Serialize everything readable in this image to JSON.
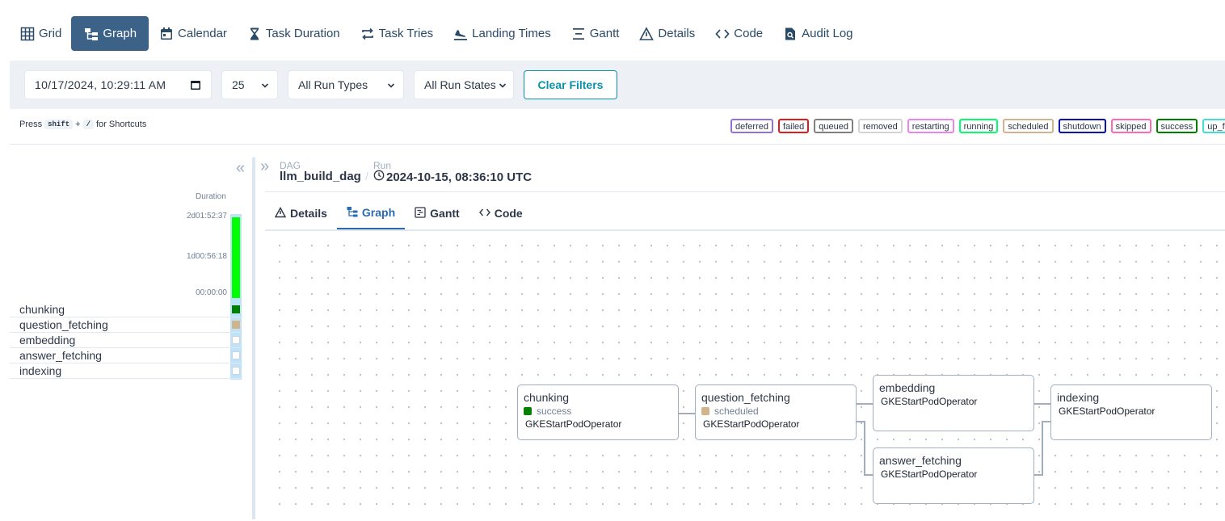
{
  "nav": [
    {
      "label": "Grid",
      "icon": "grid-icon"
    },
    {
      "label": "Graph",
      "icon": "graph-icon",
      "active": true
    },
    {
      "label": "Calendar",
      "icon": "calendar-icon"
    },
    {
      "label": "Task Duration",
      "icon": "hourglass-icon"
    },
    {
      "label": "Task Tries",
      "icon": "retry-icon"
    },
    {
      "label": "Landing Times",
      "icon": "landing-icon"
    },
    {
      "label": "Gantt",
      "icon": "gantt-icon"
    },
    {
      "label": "Details",
      "icon": "warning-icon"
    },
    {
      "label": "Code",
      "icon": "code-icon"
    },
    {
      "label": "Audit Log",
      "icon": "audit-icon"
    }
  ],
  "filters": {
    "datetime": "10/17/2024, 10:29:11 AM",
    "num_runs": "25",
    "run_types": "All Run Types",
    "run_states": "All Run States",
    "clear_label": "Clear Filters"
  },
  "shortcut": {
    "press": "Press",
    "key1": "shift",
    "plus": "+",
    "key2": "/",
    "suffix": "for Shortcuts"
  },
  "legend": [
    {
      "label": "deferred",
      "color": "#9370db"
    },
    {
      "label": "failed",
      "color": "#e01b1b"
    },
    {
      "label": "queued",
      "color": "#808080"
    },
    {
      "label": "removed",
      "color": "#d3d3d3"
    },
    {
      "label": "restarting",
      "color": "#ee82ee"
    },
    {
      "label": "running",
      "color": "#01ff70"
    },
    {
      "label": "scheduled",
      "color": "#d2b48c"
    },
    {
      "label": "shutdown",
      "color": "#0000b4"
    },
    {
      "label": "skipped",
      "color": "#ff69b4"
    },
    {
      "label": "success",
      "color": "#008000"
    },
    {
      "label": "up_for_re",
      "color": "#40e0d0"
    }
  ],
  "grid": {
    "duration_label": "Duration",
    "ticks": [
      "2d01:52:37",
      "1d00:56:18",
      "00:00:00"
    ],
    "run_bar_color": "#00ff00",
    "tasks": [
      {
        "name": "chunking",
        "state_color": "#008000"
      },
      {
        "name": "question_fetching",
        "state_color": "#d2b48c"
      },
      {
        "name": "embedding",
        "state_color": ""
      },
      {
        "name": "answer_fetching",
        "state_color": ""
      },
      {
        "name": "indexing",
        "state_color": ""
      }
    ]
  },
  "breadcrumb": {
    "dag_label": "DAG",
    "dag_id": "llm_build_dag",
    "sep": "/",
    "run_label": "Run",
    "run_id": "2024-10-15, 08:36:10 UTC"
  },
  "tabs": [
    {
      "label": "Details",
      "icon": "warning-icon"
    },
    {
      "label": "Graph",
      "icon": "graph-icon",
      "active": true
    },
    {
      "label": "Gantt",
      "icon": "gantt-icon"
    },
    {
      "label": "Code",
      "icon": "code-icon"
    }
  ],
  "graph": {
    "nodes": [
      {
        "name": "chunking",
        "state": "success",
        "state_color": "#008000",
        "operator": "GKEStartPodOperator"
      },
      {
        "name": "question_fetching",
        "state": "scheduled",
        "state_color": "#d2b48c",
        "operator": "GKEStartPodOperator"
      },
      {
        "name": "embedding",
        "state": "",
        "state_color": "",
        "operator": "GKEStartPodOperator"
      },
      {
        "name": "answer_fetching",
        "state": "",
        "state_color": "",
        "operator": "GKEStartPodOperator"
      },
      {
        "name": "indexing",
        "state": "",
        "state_color": "",
        "operator": "GKEStartPodOperator"
      }
    ]
  }
}
